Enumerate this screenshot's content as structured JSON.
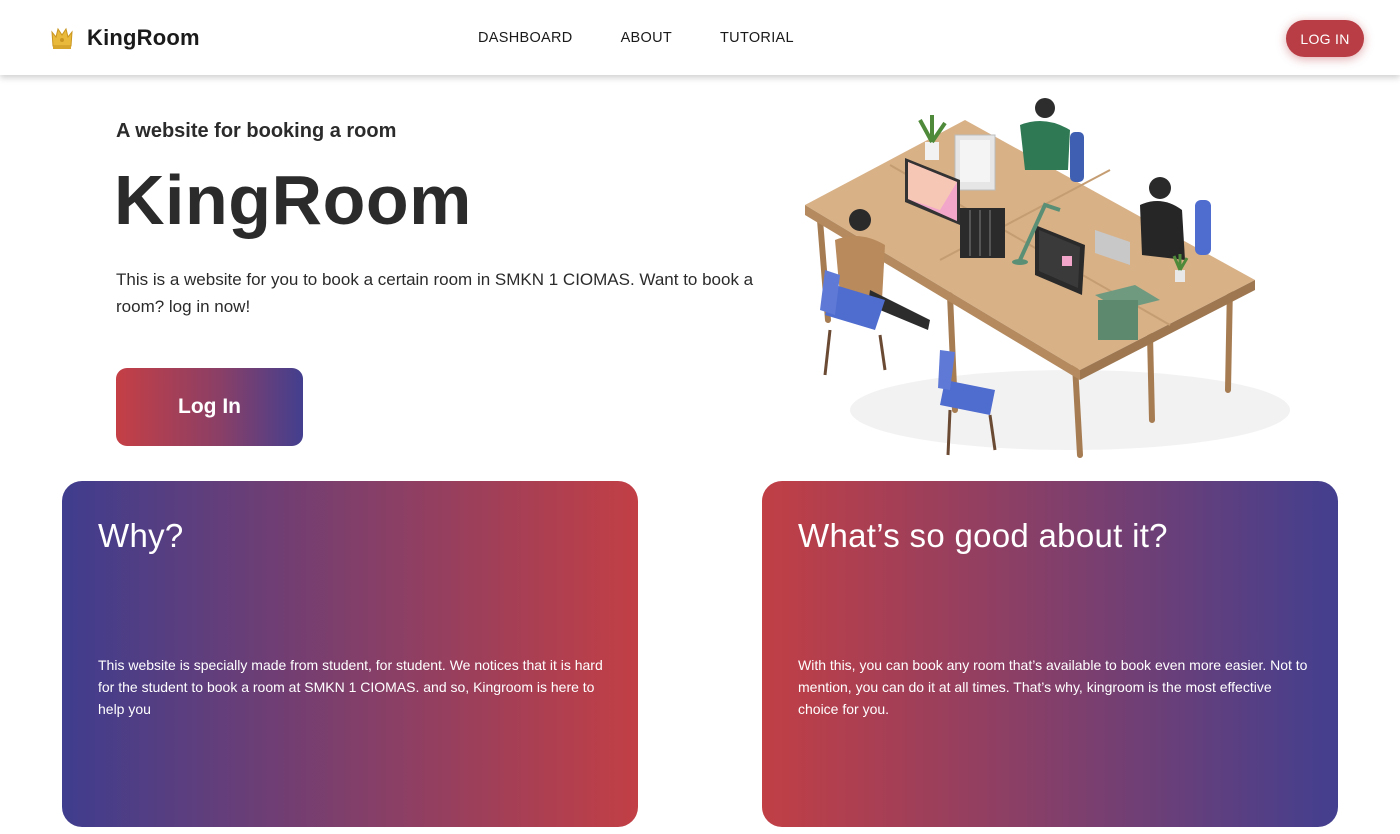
{
  "nav": {
    "brand": "KingRoom",
    "links": [
      "DASHBOARD",
      "ABOUT",
      "TUTORIAL"
    ],
    "login_label": "LOG IN"
  },
  "hero": {
    "subtitle": "A website for booking a room",
    "title": "KingRoom",
    "description": "This is a website for you to book a certain room in SMKN 1 CIOMAS. Want to book a room? log in now!",
    "login_label": "Log In"
  },
  "cards": [
    {
      "title": "Why?",
      "text": "This website is specially made from student, for student. We notices that it is hard for the student to book a room at SMKN 1 CIOMAS. and so, Kingroom is here to help you"
    },
    {
      "title": "What’s so good about it?",
      "text": "With this, you can book any room that’s available to book even more easier. Not to mention, you can do it at all times. That’s why, kingroom is the most effective choice for you."
    }
  ],
  "colors": {
    "brand_red": "#b93d44",
    "gradient_blue": "#433f8f",
    "gradient_red": "#c53f45",
    "crown": "#e8b93a"
  },
  "icons": {
    "brand": "crown-icon"
  }
}
